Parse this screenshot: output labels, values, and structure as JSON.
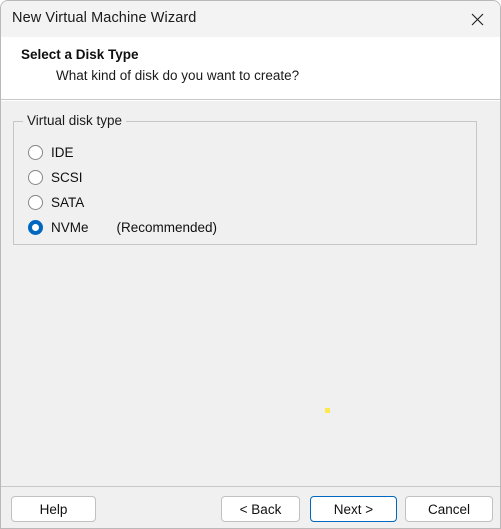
{
  "window": {
    "title": "New Virtual Machine Wizard",
    "close_icon": "close-icon"
  },
  "header": {
    "title": "Select a Disk Type",
    "subtitle": "What kind of disk do you want to create?"
  },
  "main": {
    "groupbox_label": "Virtual disk type",
    "options": [
      {
        "label": "IDE",
        "note": "",
        "selected": false
      },
      {
        "label": "SCSI",
        "note": "",
        "selected": false
      },
      {
        "label": "SATA",
        "note": "",
        "selected": false
      },
      {
        "label": "NVMe",
        "note": "(Recommended)",
        "selected": true
      }
    ]
  },
  "footer": {
    "help_label": "Help",
    "back_label": "< Back",
    "next_label": "Next >",
    "cancel_label": "Cancel"
  },
  "colors": {
    "accent": "#0067c0",
    "titlebar_bg": "#f3f3f3",
    "content_bg": "#f0f0f0",
    "artifact": "#fbe94d"
  }
}
